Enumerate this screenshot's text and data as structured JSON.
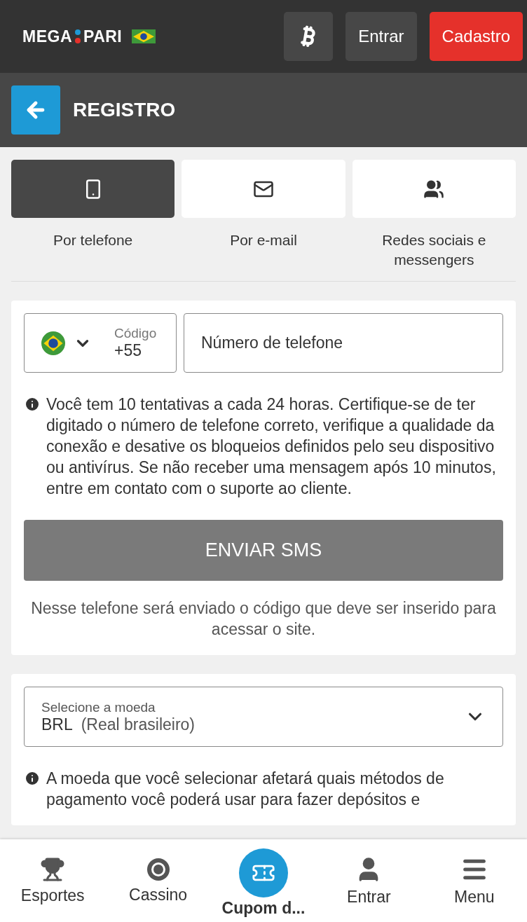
{
  "header": {
    "logo": [
      "MEGA",
      "PARI"
    ],
    "buttons": [
      {
        "kind": "icon"
      },
      {
        "kind": "plain",
        "label": "Entrar"
      },
      {
        "kind": "primary",
        "label": "Cadastro"
      }
    ]
  },
  "page_title": "REGISTRO",
  "tabs": [
    {
      "label": "Por telefone",
      "selected": true
    },
    {
      "label": "Por e-mail",
      "selected": false
    },
    {
      "label": "Redes sociais e messengers",
      "selected": false
    }
  ],
  "phone": {
    "code_label": "Código",
    "code": "+55",
    "placeholder": "Número de telefone"
  },
  "phone_info": "Você tem 10 tentativas a cada 24 horas. Certifique-se de ter digitado o número de telefone correto, verifique a qualidade da conexão e desative os bloqueios definidos pelo seu dispositivo ou antivírus. Se não receber uma mensagem após 10 minutos, entre em contato com o suporte ao cliente.",
  "send_button": {
    "label": "ENVIAR SMS",
    "disabled": true
  },
  "send_note": "Nesse telefone será enviado o código que deve ser inserido para acessar o site.",
  "currency": {
    "label": "Selecione a moeda",
    "code": "BRL",
    "name": "(Real brasileiro)"
  },
  "currency_info": "A moeda que você selecionar afetará quais métodos de pagamento você poderá usar para fazer depósitos e",
  "bottom_nav": [
    {
      "label": "Esportes",
      "kind": "plain"
    },
    {
      "label": "Cassino",
      "kind": "plain"
    },
    {
      "label": "Cupom d...",
      "kind": "featured"
    },
    {
      "label": "Entrar",
      "kind": "plain"
    },
    {
      "label": "Menu",
      "kind": "plain"
    }
  ]
}
